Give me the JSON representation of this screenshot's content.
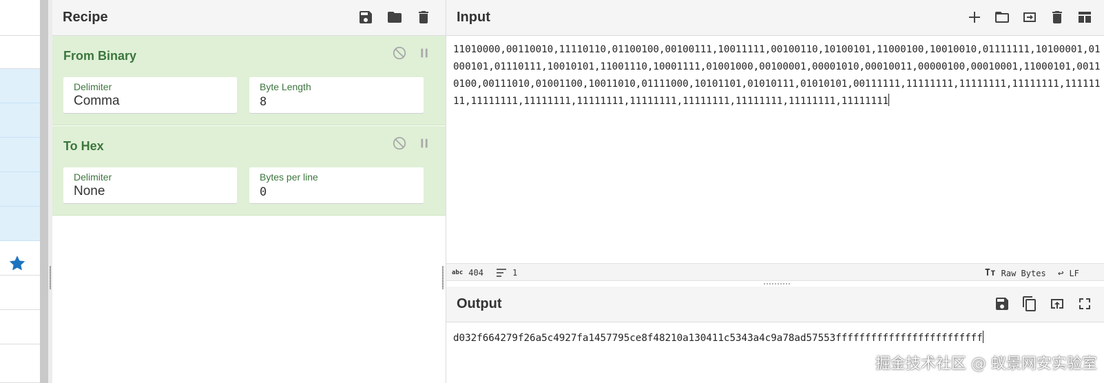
{
  "recipe": {
    "title": "Recipe",
    "operations": [
      {
        "name": "From Binary",
        "args": [
          {
            "label": "Delimiter",
            "value": "Comma"
          },
          {
            "label": "Byte Length",
            "value": "8"
          }
        ]
      },
      {
        "name": "To Hex",
        "args": [
          {
            "label": "Delimiter",
            "value": "None"
          },
          {
            "label": "Bytes per line",
            "value": "0"
          }
        ]
      }
    ]
  },
  "input": {
    "title": "Input",
    "text": "11010000,00110010,11110110,01100100,00100111,10011111,00100110,10100101,11000100,10010010,01111111,10100001,01000101,01110111,10010101,11001110,10001111,01001000,00100001,00001010,00010011,00000100,00010001,11000101,00110100,00111010,01001100,10011010,01111000,10101101,01010111,01010101,00111111,11111111,11111111,11111111,11111111,11111111,11111111,11111111,11111111,11111111,11111111,11111111,11111111",
    "status": {
      "length_label": "404",
      "lines_label": "1",
      "charset": "Raw Bytes",
      "eol": "LF"
    }
  },
  "output": {
    "title": "Output",
    "text": "d032f664279f26a5c4927fa1457795ce8f48210a130411c5343a4c9a78ad57553fffffffffffffffffffffffff"
  },
  "watermark": "掘金技术社区 @ 蚁景网安实验室",
  "colors": {
    "op_bg": "#dff0d6",
    "op_title": "#3c763d",
    "ops_highlight": "#dff0fb",
    "star": "#1e73be"
  }
}
